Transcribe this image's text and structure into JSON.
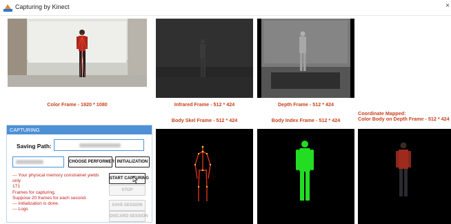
{
  "window": {
    "title": "Capturing by Kinect",
    "close_glyph": "×",
    "icon": "kinect-app-icon"
  },
  "frames": {
    "color": {
      "caption": "Color Frame - 1920 * 1080"
    },
    "infrared": {
      "caption": "Infrared Frame - 512 * 424"
    },
    "depth": {
      "caption": "Depth Frame - 512 * 424"
    },
    "mapped": {
      "caption_line1": "Coordinate Mapped:",
      "caption_line2": "Color Body on Depth Frame - 512 * 424"
    },
    "body_skel": {
      "caption": "Body Skel Frame - 512 * 424"
    },
    "body_index": {
      "caption": "Body Index Frame - 512 * 424"
    }
  },
  "capture_panel": {
    "header": "CAPTURING",
    "saving_path_label": "Saving Path:",
    "choose_performer": "CHOOSE PERFORMER",
    "initialization": "INITIALIZATION",
    "start_capturing": "START CAPTURING",
    "stop": "STOP",
    "save_session": "SAVE SESSION",
    "discard_session": "DISCARD SESSION",
    "log_lines": [
      "--- Your physical memory constrainet yields",
      "only",
      "171",
      "Frames for capturing.",
      "Suppose 20 frames for each second.",
      " --- Initialization is done.",
      " --- Logs"
    ]
  },
  "colors": {
    "accent": "#4e90d6",
    "caption": "#c8401d",
    "log_text": "#c51a1a",
    "body_index_green": "#22dd22",
    "skeleton_red": "#e0301e"
  }
}
